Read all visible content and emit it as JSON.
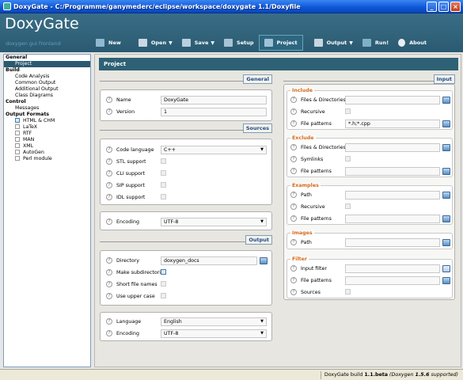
{
  "window": {
    "title": "DoxyGate - C:/Programme/ganymederc/eclipse/workspace/doxygate 1.1/Doxyfile"
  },
  "header": {
    "brand": "DoxyGate",
    "tagline": "doxygen gui frontend"
  },
  "toolbar": {
    "new": "New",
    "open": "Open",
    "save": "Save",
    "setup": "Setup",
    "project": "Project",
    "output": "Output",
    "run": "Run!",
    "about": "About"
  },
  "sidebar": {
    "general": "General",
    "project": "Project",
    "build": "Build",
    "code_analysis": "Code Analysis",
    "common_output": "Common Output",
    "additional_output": "Additional Output",
    "class_diagrams": "Class Diagrams",
    "control": "Control",
    "messages": "Messages",
    "output_formats": "Output Formats",
    "html": "HTML & CHM",
    "latex": "LaTeX",
    "rtf": "RTF",
    "man": "MAN",
    "xml": "XML",
    "autogen": "AutoGen",
    "perl": "Perl module"
  },
  "content": {
    "heading": "Project",
    "general": {
      "title": "General",
      "name_label": "Name",
      "name_value": "DoxyGate",
      "version_label": "Version",
      "version_value": "1"
    },
    "sources": {
      "title": "Sources",
      "code_language_label": "Code language",
      "code_language_value": "C++",
      "stl_label": "STL support",
      "cli_label": "CLI support",
      "sip_label": "SIP support",
      "idl_label": "IDL support",
      "encoding_label": "Encoding",
      "encoding_value": "UTF-8"
    },
    "output": {
      "title": "Output",
      "directory_label": "Directory",
      "directory_value": "doxygen_docs",
      "make_subdirs_label": "Make subdirectories",
      "short_names_label": "Short file names",
      "upper_case_label": "Use upper case",
      "language_label": "Language",
      "language_value": "English",
      "encoding_label": "Encoding",
      "encoding_value": "UTF-8"
    },
    "input": {
      "title": "Input",
      "include": {
        "title": "Include",
        "files_label": "Files & Directories",
        "recursive_label": "Recursive",
        "patterns_label": "File patterns",
        "patterns_value": "*.h;*.cpp"
      },
      "exclude": {
        "title": "Exclude",
        "files_label": "Files & Directories",
        "symlinks_label": "Symlinks",
        "patterns_label": "File patterns"
      },
      "examples": {
        "title": "Examples",
        "path_label": "Path",
        "recursive_label": "Recursive",
        "patterns_label": "File patterns"
      },
      "images": {
        "title": "Images",
        "path_label": "Path"
      },
      "filter": {
        "title": "Filter",
        "input_filter_label": "Input filter",
        "patterns_label": "File patterns",
        "sources_label": "Sources"
      }
    }
  },
  "status": {
    "prefix": "DoxyGate build",
    "build": "1.1.beta",
    "doxygen_prefix": "(Doxygen",
    "doxygen_version": "1.5.6",
    "doxygen_suffix": "supported)"
  },
  "colors": {
    "header": "#2a5a72",
    "accent_orange": "#d36a1a",
    "accent_blue": "#1d4c8c"
  }
}
